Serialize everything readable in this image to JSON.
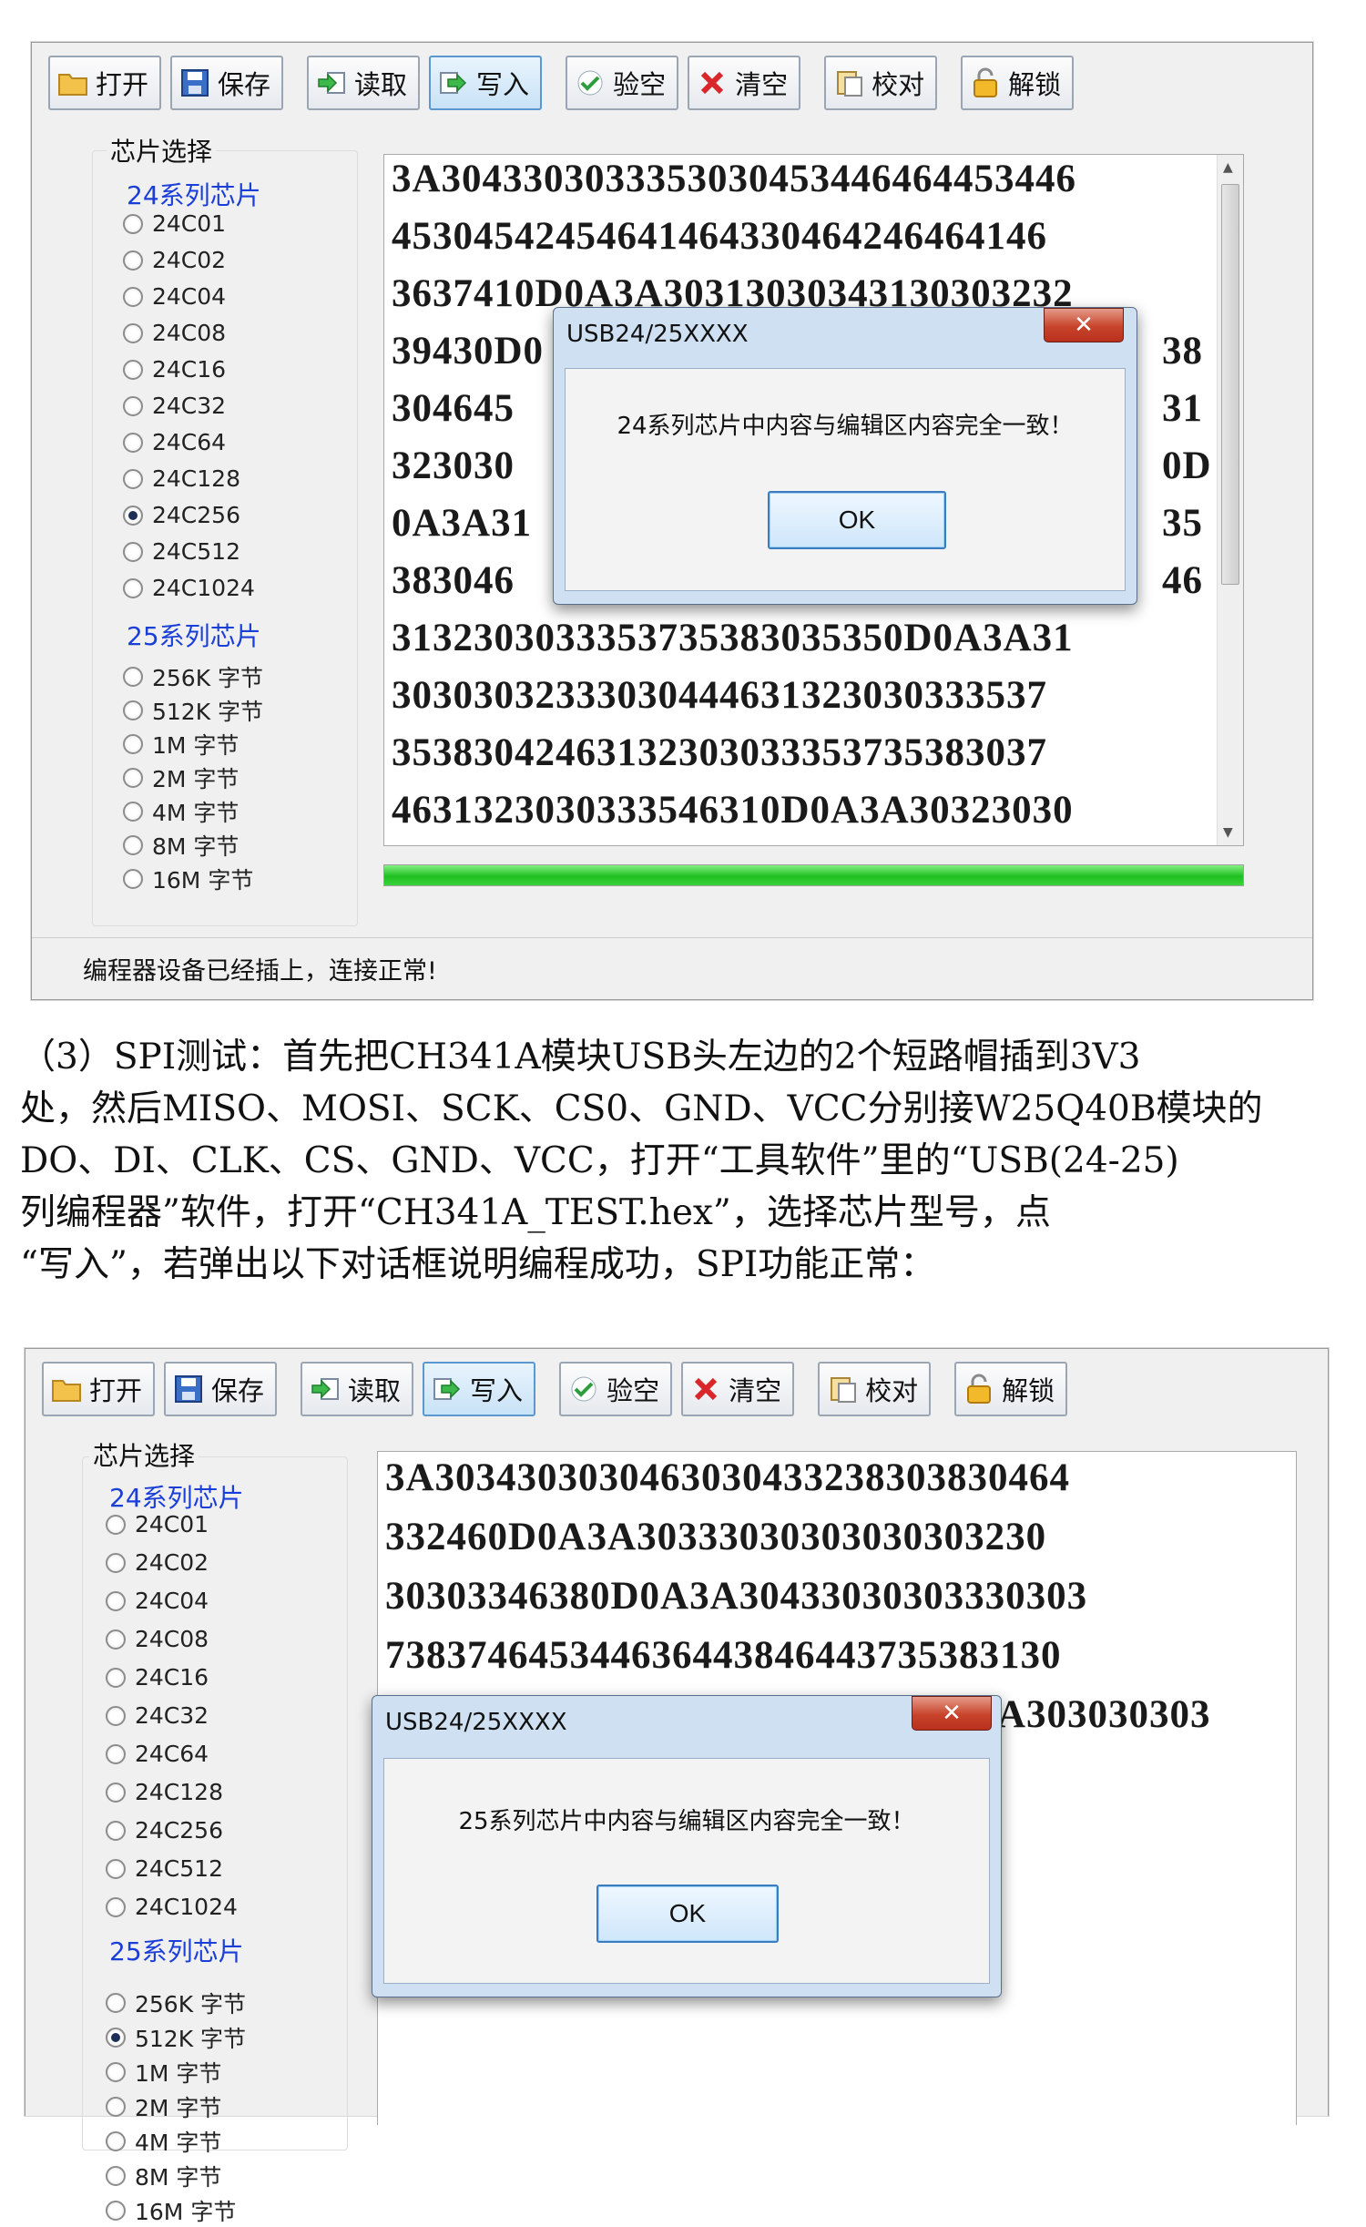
{
  "toolbar": {
    "open": "打开",
    "save": "保存",
    "read": "读取",
    "write": "写入",
    "blank_check": "验空",
    "erase": "清空",
    "verify": "校对",
    "unlock": "解锁"
  },
  "chip_select": {
    "title": "芯片选择",
    "series24_title": "24系列芯片",
    "series24": [
      "24C01",
      "24C02",
      "24C04",
      "24C08",
      "24C16",
      "24C32",
      "24C64",
      "24C128",
      "24C256",
      "24C512",
      "24C1024"
    ],
    "series25_title": "25系列芯片",
    "series25": [
      "256K 字节",
      "512K 字节",
      "1M 字节",
      "2M 字节",
      "4M 字节",
      "8M 字节",
      "16M 字节"
    ]
  },
  "window1": {
    "selected_24": "24C256",
    "hex_lines": [
      "3A3043303033353030453446464453446",
      "4530454245464146433046424646414 6",
      "3637410D0A3A30313030343130303232",
      "39430D0",
      "304645",
      "323030",
      "0A3A31",
      "383046",
      "31323030333537353830353 50D0A3A31",
      "3030303233303044463132303033353 7",
      "35383042463132303033353735383037",
      "4631323030333546310D0A3A30323030"
    ],
    "hex_right_tails": [
      "38",
      "31",
      "0D",
      "35",
      "46"
    ],
    "progress": 1.0,
    "status": "编程器设备已经插上，连接正常!",
    "dialog": {
      "title": "USB24/25XXXX",
      "message": "24系列芯片中内容与编辑区内容完全一致！",
      "ok": "OK",
      "close": "✕"
    }
  },
  "paragraph": [
    "（3）SPI测试：首先把CH341A模块USB头左边的2个短路帽插到3V3",
    "处，然后MISO、MOSI、SCK、CS0、GND、VCC分别接W25Q40B模块的",
    "DO、DI、CLK、CS、GND、VCC，打开“工具软件”里的“USB(24-25)",
    "列编程器”软件，打开“CH341A_TEST.hex”，选择芯片型号，点",
    "“写入”，若弹出以下对话框说明编程成功，SPI功能正常："
  ],
  "window2": {
    "selected_25": "512K 字节",
    "hex_lines": [
      "3A303430303046303043323830383046 4",
      "332460D0A3A30333030303030303230",
      "30303346380D0A3A304330303033303 03",
      "738374645344636443846443735383130"
    ],
    "hex_right_tail": "A303030303",
    "dialog": {
      "title": "USB24/25XXXX",
      "message": "25系列芯片中内容与编辑区内容完全一致！",
      "ok": "OK",
      "close": "✕"
    }
  },
  "icons": {
    "open": "folder-icon",
    "save": "floppy-icon",
    "read": "arrow-read-icon",
    "write": "arrow-write-icon",
    "blank_check": "check-icon",
    "erase": "red-x-icon",
    "verify": "clipboard-icon",
    "unlock": "padlock-icon"
  },
  "colors": {
    "series_title": "#1a3ed8",
    "progress": "#1fbf1f",
    "dialog_frame": "#cfe0f2",
    "close_button": "#c8432a"
  }
}
